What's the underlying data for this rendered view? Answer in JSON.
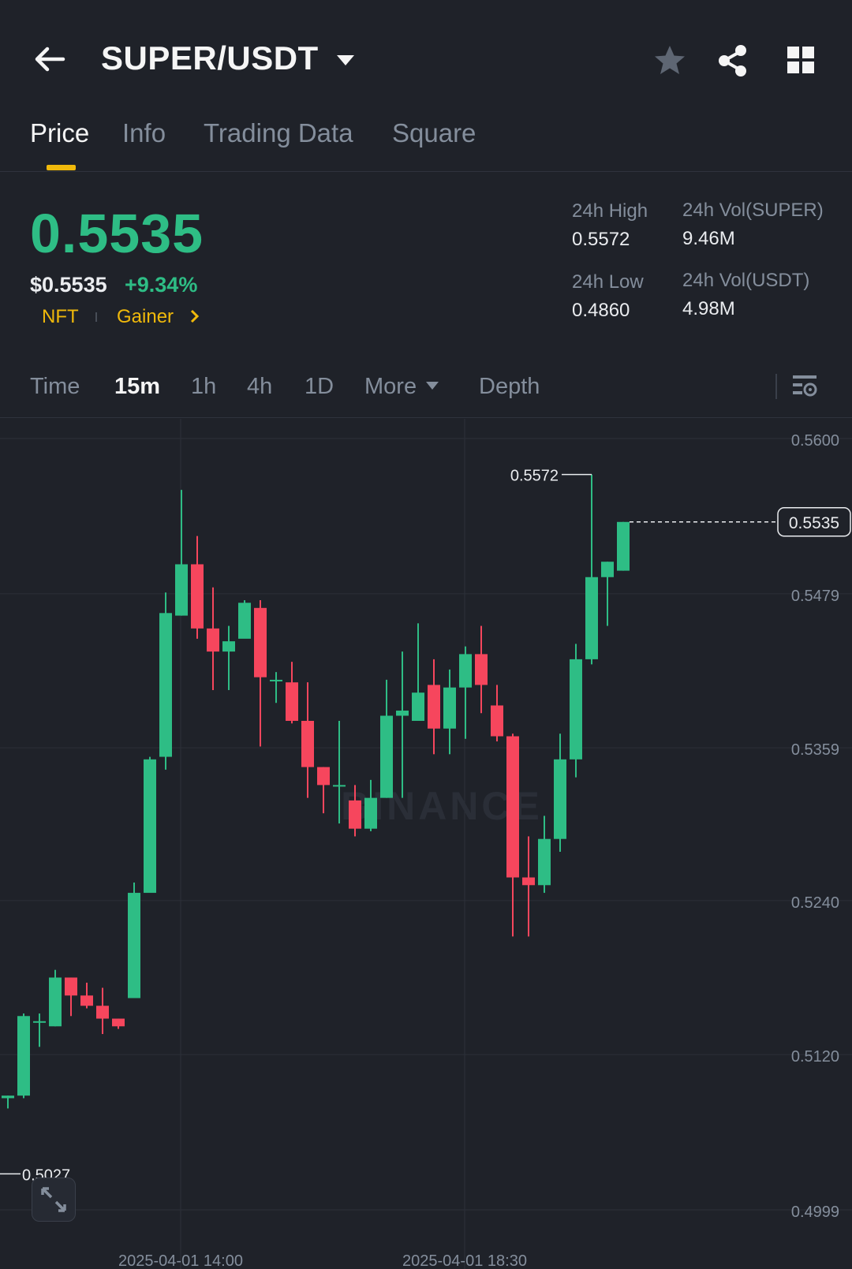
{
  "header": {
    "title": "SUPER/USDT",
    "icons": [
      "back-arrow-icon",
      "dropdown-caret-icon",
      "star-icon",
      "share-icon",
      "grid-icon"
    ]
  },
  "tabs": [
    {
      "label": "Price",
      "active": true
    },
    {
      "label": "Info",
      "active": false
    },
    {
      "label": "Trading Data",
      "active": false
    },
    {
      "label": "Square",
      "active": false
    }
  ],
  "price": {
    "last": "0.5535",
    "usd": "$0.5535",
    "change": "+9.34%",
    "tags": [
      "NFT",
      "Gainer"
    ]
  },
  "stats": {
    "high_label": "24h High",
    "high_value": "0.5572",
    "low_label": "24h Low",
    "low_value": "0.4860",
    "vol_base_label": "24h Vol(SUPER)",
    "vol_base_value": "9.46M",
    "vol_quote_label": "24h Vol(USDT)",
    "vol_quote_value": "4.98M"
  },
  "intervals": {
    "items": [
      "Time",
      "15m",
      "1h",
      "4h",
      "1D",
      "More",
      "Depth"
    ],
    "active": "15m"
  },
  "colors": {
    "up": "#2ebd85",
    "down": "#f6465d",
    "accent": "#f0b90b",
    "background": "#1f2229"
  },
  "chart_data": {
    "type": "candlestick",
    "interval": "15m",
    "watermark": "BINANCE",
    "y_ticks": [
      "0.5600",
      "0.5479",
      "0.5359",
      "0.5240",
      "0.5120",
      "0.4999"
    ],
    "ylim": [
      0.4999,
      0.56
    ],
    "x_ticks": [
      "2025-04-01 14:00",
      "2025-04-01 18:30"
    ],
    "last_price_label": "0.5535",
    "high_marker": "0.5572",
    "low_marker": "0.5027",
    "candles": [
      {
        "o": 0.5086,
        "h": 0.5088,
        "l": 0.5078,
        "c": 0.5088
      },
      {
        "o": 0.5088,
        "h": 0.5152,
        "l": 0.5086,
        "c": 0.515
      },
      {
        "o": 0.5146,
        "h": 0.5152,
        "l": 0.5126,
        "c": 0.5146
      },
      {
        "o": 0.5142,
        "h": 0.5186,
        "l": 0.5142,
        "c": 0.518
      },
      {
        "o": 0.518,
        "h": 0.518,
        "l": 0.515,
        "c": 0.5166
      },
      {
        "o": 0.5166,
        "h": 0.5176,
        "l": 0.5156,
        "c": 0.5158
      },
      {
        "o": 0.5158,
        "h": 0.5172,
        "l": 0.5136,
        "c": 0.5148
      },
      {
        "o": 0.5148,
        "h": 0.5148,
        "l": 0.514,
        "c": 0.5142
      },
      {
        "o": 0.5164,
        "h": 0.5254,
        "l": 0.5164,
        "c": 0.5246
      },
      {
        "o": 0.5246,
        "h": 0.5352,
        "l": 0.5246,
        "c": 0.535
      },
      {
        "o": 0.5352,
        "h": 0.548,
        "l": 0.5342,
        "c": 0.5464
      },
      {
        "o": 0.5462,
        "h": 0.556,
        "l": 0.5462,
        "c": 0.5502
      },
      {
        "o": 0.5502,
        "h": 0.5524,
        "l": 0.5444,
        "c": 0.5452
      },
      {
        "o": 0.5452,
        "h": 0.5484,
        "l": 0.5404,
        "c": 0.5434
      },
      {
        "o": 0.5434,
        "h": 0.5454,
        "l": 0.5404,
        "c": 0.5442
      },
      {
        "o": 0.5444,
        "h": 0.5474,
        "l": 0.545,
        "c": 0.5472
      },
      {
        "o": 0.5468,
        "h": 0.5474,
        "l": 0.536,
        "c": 0.5414
      },
      {
        "o": 0.5412,
        "h": 0.5418,
        "l": 0.5394,
        "c": 0.5412
      },
      {
        "o": 0.541,
        "h": 0.5426,
        "l": 0.5378,
        "c": 0.538
      },
      {
        "o": 0.538,
        "h": 0.541,
        "l": 0.532,
        "c": 0.5344
      },
      {
        "o": 0.5344,
        "h": 0.5344,
        "l": 0.5308,
        "c": 0.533
      },
      {
        "o": 0.533,
        "h": 0.538,
        "l": 0.53,
        "c": 0.533
      },
      {
        "o": 0.5318,
        "h": 0.533,
        "l": 0.529,
        "c": 0.5296
      },
      {
        "o": 0.5296,
        "h": 0.5334,
        "l": 0.5294,
        "c": 0.532
      },
      {
        "o": 0.532,
        "h": 0.5412,
        "l": 0.532,
        "c": 0.5384
      },
      {
        "o": 0.5384,
        "h": 0.5434,
        "l": 0.532,
        "c": 0.5388
      },
      {
        "o": 0.538,
        "h": 0.5456,
        "l": 0.538,
        "c": 0.5402
      },
      {
        "o": 0.5408,
        "h": 0.5428,
        "l": 0.5354,
        "c": 0.5374
      },
      {
        "o": 0.5374,
        "h": 0.542,
        "l": 0.5354,
        "c": 0.5406
      },
      {
        "o": 0.5406,
        "h": 0.5438,
        "l": 0.5366,
        "c": 0.5432
      },
      {
        "o": 0.5432,
        "h": 0.5454,
        "l": 0.5386,
        "c": 0.5408
      },
      {
        "o": 0.5392,
        "h": 0.5408,
        "l": 0.5364,
        "c": 0.5368
      },
      {
        "o": 0.5368,
        "h": 0.537,
        "l": 0.5212,
        "c": 0.5258
      },
      {
        "o": 0.5258,
        "h": 0.529,
        "l": 0.5212,
        "c": 0.5252
      },
      {
        "o": 0.5252,
        "h": 0.5306,
        "l": 0.5246,
        "c": 0.5288
      },
      {
        "o": 0.5288,
        "h": 0.537,
        "l": 0.5278,
        "c": 0.535
      },
      {
        "o": 0.535,
        "h": 0.544,
        "l": 0.5336,
        "c": 0.5428
      },
      {
        "o": 0.5428,
        "h": 0.5572,
        "l": 0.5424,
        "c": 0.5492
      },
      {
        "o": 0.5492,
        "h": 0.5504,
        "l": 0.5454,
        "c": 0.5504
      },
      {
        "o": 0.5497,
        "h": 0.5535,
        "l": 0.5497,
        "c": 0.5535
      }
    ]
  }
}
